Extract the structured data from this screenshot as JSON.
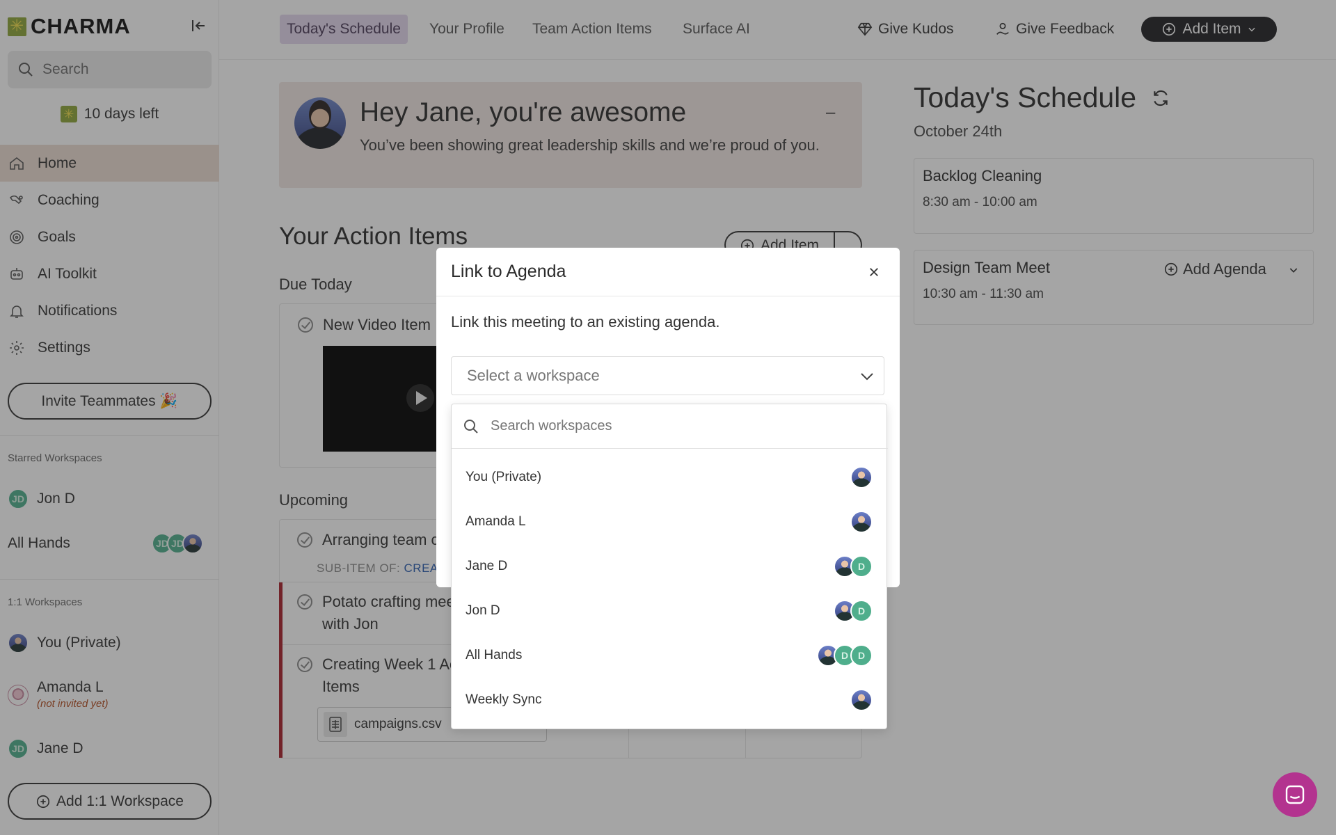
{
  "app": {
    "logo_text": "CHARMA"
  },
  "sidebar": {
    "search_placeholder": "Search",
    "trial_text": "10 days left",
    "nav": [
      {
        "label": "Home",
        "icon": "home-icon",
        "active": true
      },
      {
        "label": "Coaching",
        "icon": "coaching-icon"
      },
      {
        "label": "Goals",
        "icon": "target-icon"
      },
      {
        "label": "AI Toolkit",
        "icon": "robot-icon"
      },
      {
        "label": "Notifications",
        "icon": "bell-icon"
      },
      {
        "label": "Settings",
        "icon": "gear-icon"
      }
    ],
    "invite_label": "Invite Teammates 🎉",
    "starred_label": "Starred Workspaces",
    "starred": [
      {
        "name": "Jon D",
        "initials": "JD"
      },
      {
        "name": "All Hands",
        "initials_1": "JD",
        "initials_2": "JD"
      }
    ],
    "one_on_one_label": "1:1 Workspaces",
    "one_on_one": [
      {
        "name": "You (Private)"
      },
      {
        "name": "Amanda L",
        "note": "(not invited yet)"
      },
      {
        "name": "Jane D",
        "initials": "JD"
      }
    ],
    "add_workspace_label": "Add 1:1 Workspace"
  },
  "topbar": {
    "tabs": [
      {
        "label": "Today's Schedule",
        "active": true
      },
      {
        "label": "Your Profile"
      },
      {
        "label": "Team Action Items"
      },
      {
        "label": "Surface AI"
      }
    ],
    "give_kudos": "Give Kudos",
    "give_feedback": "Give Feedback",
    "add_item": "Add Item"
  },
  "banner": {
    "title": "Hey Jane, you're awesome",
    "subtitle": "You’ve been showing great leadership skills and we’re proud of you.",
    "minimize": "–"
  },
  "action_items": {
    "title": "Your Action Items",
    "add_item_label": "Add Item",
    "due_today_label": "Due Today",
    "due_today": [
      {
        "title": "New Video Item"
      }
    ],
    "upcoming_label": "Upcoming",
    "upcoming": [
      {
        "title": "Arranging team c",
        "subitem_prefix": "SUB-ITEM OF:",
        "subitem_link": "CREAT"
      },
      {
        "title_line1": "Potato crafting mee",
        "title_line2": "with Jon"
      },
      {
        "title_line1": "Creating Week 1 Ac",
        "title_line2": "Items",
        "attachment": "campaigns.csv"
      }
    ]
  },
  "schedule": {
    "title": "Today's Schedule",
    "date": "October 24th",
    "meetings": [
      {
        "title": "Backlog Cleaning",
        "time": "8:30 am - 10:00 am"
      },
      {
        "title": "Design Team Meet",
        "time": "10:30 am - 11:30 am",
        "action": "Add Agenda"
      }
    ]
  },
  "modal": {
    "title": "Link to Agenda",
    "description": "Link this meeting to an existing agenda.",
    "select_placeholder": "Select a workspace",
    "search_placeholder": "Search workspaces",
    "options": [
      {
        "label": "You (Private)"
      },
      {
        "label": "Amanda L"
      },
      {
        "label": "Jane D",
        "initials": "D"
      },
      {
        "label": "Jon D",
        "initials": "D"
      },
      {
        "label": "All Hands",
        "initials_1": "D",
        "initials_2": "D"
      },
      {
        "label": "Weekly Sync"
      }
    ]
  },
  "colors": {
    "accent_dark": "#1f1f23",
    "active_tab_bg": "#e4d7ee",
    "active_nav_bg": "#ecdcd3",
    "banner_bg": "#f1e7e4",
    "overdue_bar": "#a8202a",
    "chat_button": "#b3338f",
    "avatar_green": "#4fae8c"
  }
}
